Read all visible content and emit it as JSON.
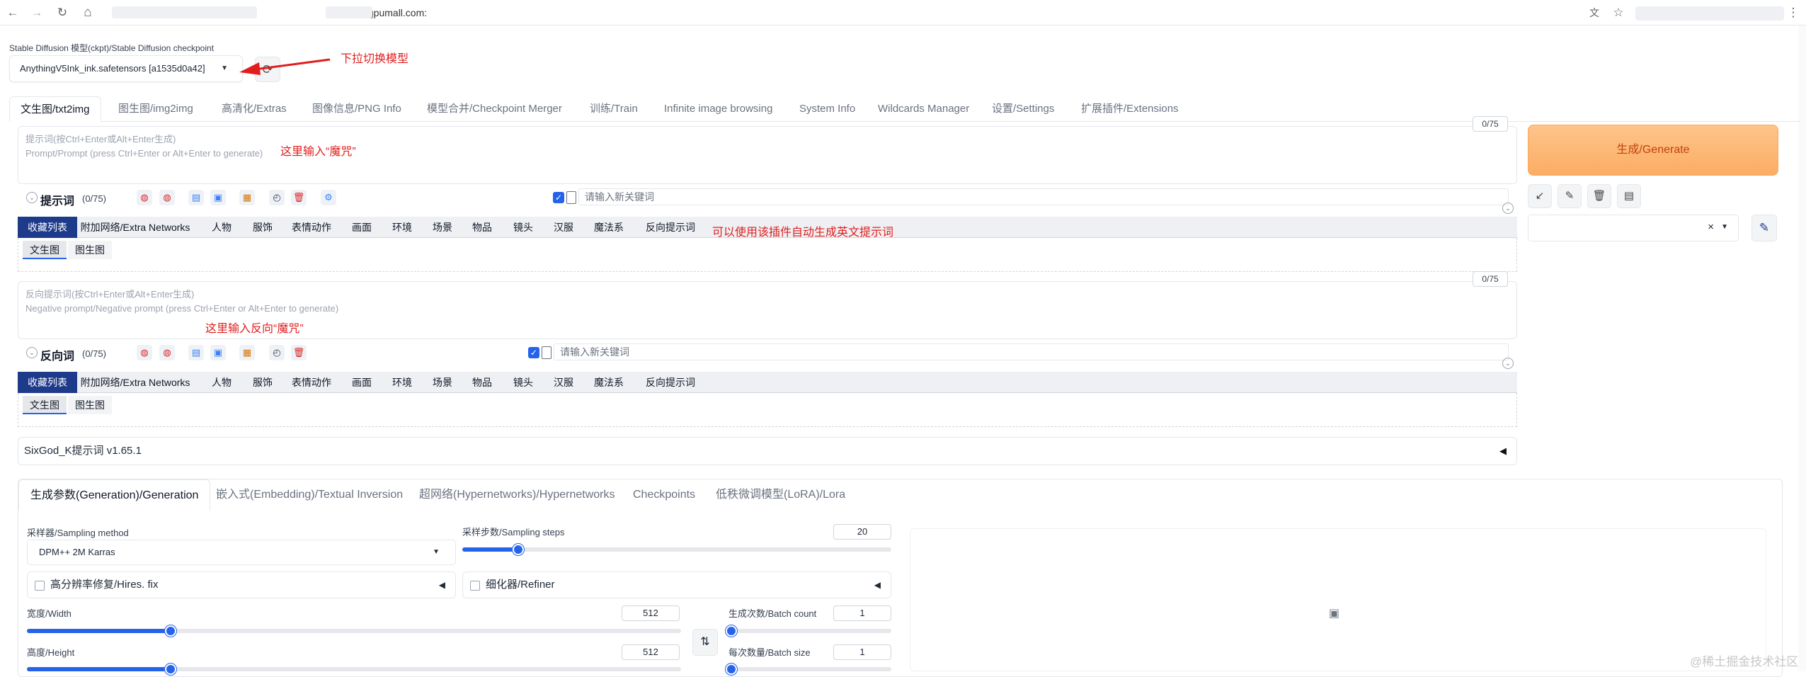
{
  "browser": {
    "url_visible": ".gpumall.com:",
    "back_icon": "←",
    "forward_icon": "→",
    "reload_icon": "↻",
    "home_icon": "⌂",
    "translate_icon": "文",
    "star_icon": "☆",
    "menu_icon": "⋮"
  },
  "model": {
    "label": "Stable Diffusion 模型(ckpt)/Stable Diffusion checkpoint",
    "value": "AnythingV5Ink_ink.safetensors [a1535d0a42]",
    "annotation": "下拉切换模型"
  },
  "tabs": [
    "文生图/txt2img",
    "图生图/img2img",
    "高清化/Extras",
    "图像信息/PNG Info",
    "模型合并/Checkpoint Merger",
    "训练/Train",
    "Infinite image browsing",
    "System Info",
    "Wildcards Manager",
    "设置/Settings",
    "扩展插件/Extensions"
  ],
  "prompt": {
    "placeholder_line1": "提示词(按Ctrl+Enter或Alt+Enter生成)",
    "placeholder_line2": "Prompt/Prompt (press Ctrl+Enter or Alt+Enter to generate)",
    "annotation": "这里输入“魔咒”",
    "counter": "0/75",
    "tool_label": "提示词",
    "tool_count": "(0/75)",
    "keyword_placeholder": "请输入新关键词"
  },
  "negative": {
    "placeholder_line1": "反向提示词(按Ctrl+Enter或Alt+Enter生成)",
    "placeholder_line2": "Negative prompt/Negative prompt (press Ctrl+Enter or Alt+Enter to generate)",
    "annotation": "这里输入反向“魔咒”",
    "counter": "0/75",
    "tool_label": "反向词",
    "tool_count": "(0/75)",
    "keyword_placeholder": "请输入新关键词"
  },
  "categories": [
    "收藏列表",
    "附加网络/Extra Networks",
    "人物",
    "服饰",
    "表情动作",
    "画面",
    "环境",
    "场景",
    "物品",
    "镜头",
    "汉服",
    "魔法系",
    "反向提示词"
  ],
  "category_annotation": "可以使用该插件自动生成英文提示词",
  "sub_tabs": [
    "文生图",
    "图生图"
  ],
  "sixgod": {
    "title": "SixGod_K提示词 v1.65.1"
  },
  "gen_tabs": [
    "生成参数(Generation)/Generation",
    "嵌入式(Embedding)/Textual Inversion",
    "超网络(Hypernetworks)/Hypernetworks",
    "Checkpoints",
    "低秩微调模型(LoRA)/Lora"
  ],
  "generation": {
    "sampler_label": "采样器/Sampling method",
    "sampler_value": "DPM++ 2M Karras",
    "steps_label": "采样步数/Sampling steps",
    "steps_value": "20",
    "steps_frac": 0.13,
    "hires_label": "高分辨率修复/Hires. fix",
    "refiner_label": "细化器/Refiner",
    "width_label": "宽度/Width",
    "width_value": "512",
    "width_frac": 0.22,
    "height_label": "高度/Height",
    "height_value": "512",
    "height_frac": 0.22,
    "batch_count_label": "生成次数/Batch count",
    "batch_count_value": "1",
    "batch_size_label": "每次数量/Batch size",
    "batch_size_value": "1"
  },
  "right": {
    "generate_label": "生成/Generate",
    "style_clear": "×"
  },
  "watermark": "@稀土掘金技术社区",
  "colors": {
    "accent": "#2563eb",
    "generate_bg": "#fbad63",
    "annotation_red": "#e11d1d",
    "category_active": "#1e3a8a"
  }
}
